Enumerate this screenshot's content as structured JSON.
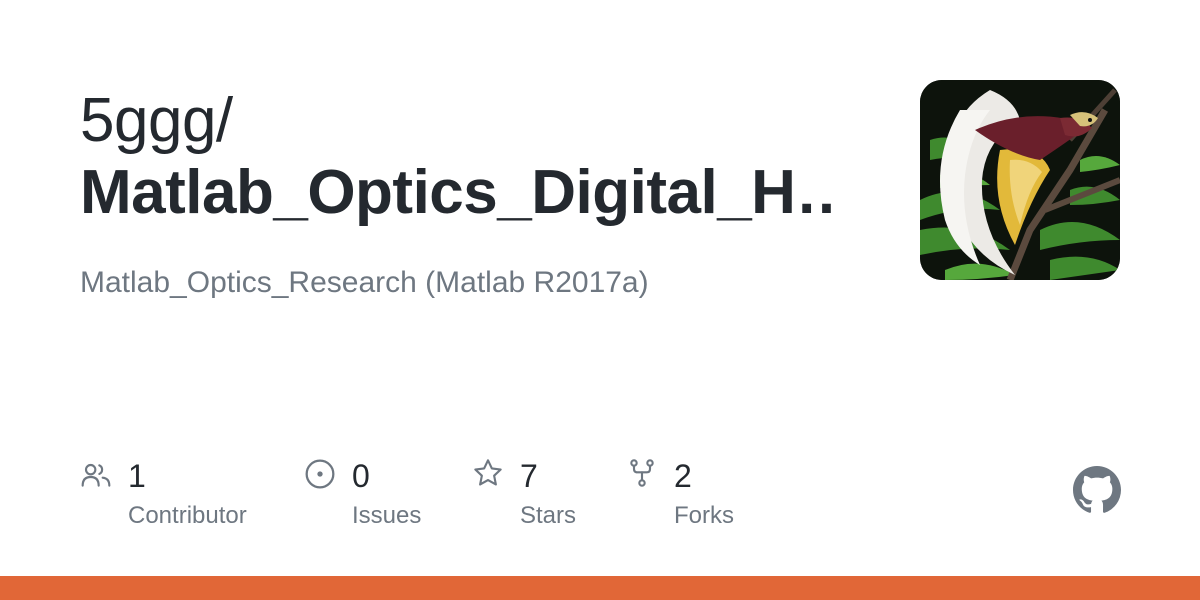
{
  "owner": "5ggg/",
  "repo_name": "Matlab_Optics_Digital_H…",
  "description": "Matlab_Optics_Research (Matlab R2017a)",
  "stats": [
    {
      "icon": "people-icon",
      "value": "1",
      "label": "Contributor"
    },
    {
      "icon": "issue-icon",
      "value": "0",
      "label": "Issues"
    },
    {
      "icon": "star-icon",
      "value": "7",
      "label": "Stars"
    },
    {
      "icon": "fork-icon",
      "value": "2",
      "label": "Forks"
    }
  ],
  "icons": {
    "logo": "github-icon",
    "avatar": "avatar-image"
  },
  "colors": {
    "text": "#24292f",
    "muted": "#6e7781",
    "language_bar": "#e16737",
    "logo": "#6e7781"
  }
}
